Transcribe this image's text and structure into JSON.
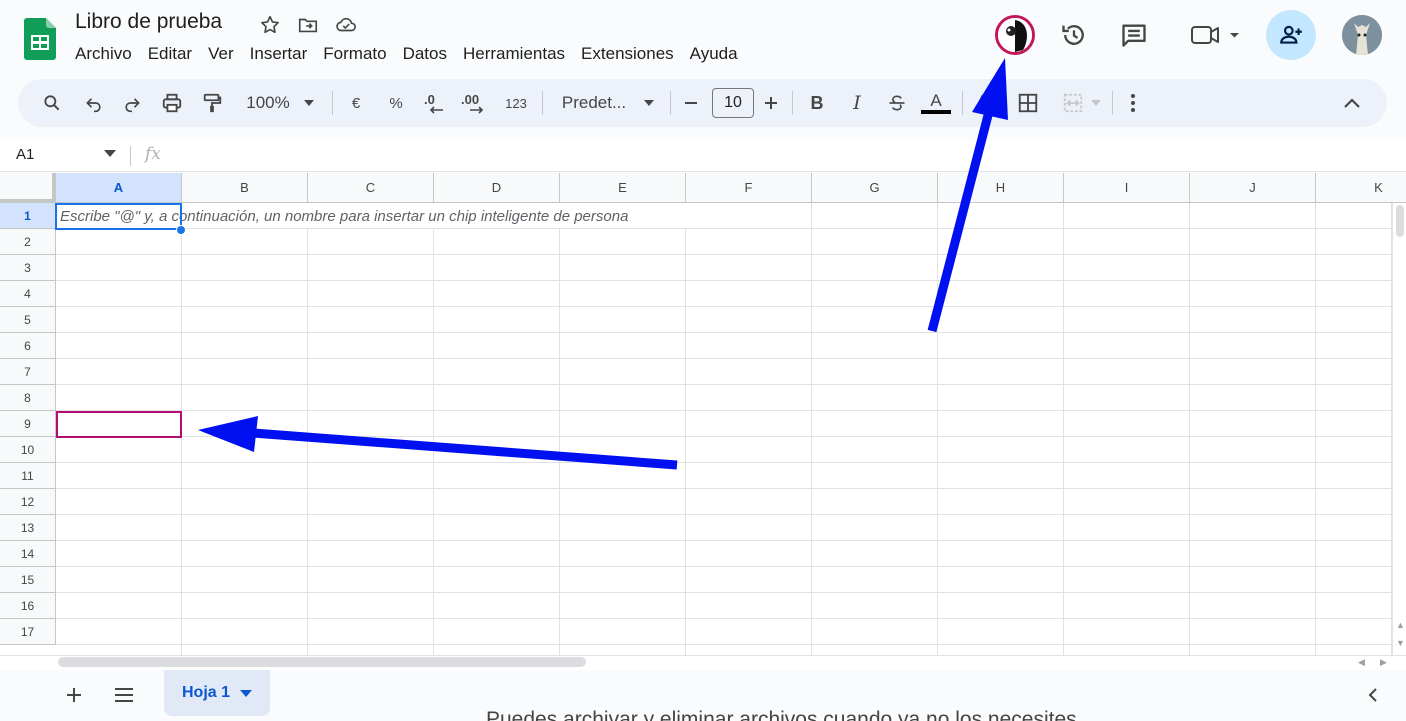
{
  "app": {
    "doc_title": "Libro de prueba",
    "brand_color": "#0f9d58",
    "accent_color": "#1a73e8",
    "collaborator_color": "#b10d75"
  },
  "title_icons": [
    "star-icon",
    "move-to-folder-icon",
    "cloud-saved-icon"
  ],
  "menu": [
    "Archivo",
    "Editar",
    "Ver",
    "Insertar",
    "Formato",
    "Datos",
    "Herramientas",
    "Extensiones",
    "Ayuda"
  ],
  "header_right": [
    "collaborator-avatar",
    "version-history-icon",
    "comments-icon",
    "meet-icon",
    "share-button",
    "user-avatar"
  ],
  "toolbar": {
    "zoom": "100%",
    "currency": "€",
    "percent": "%",
    "decrease_decimals": ".0",
    "increase_decimals": ".00",
    "number_format": "123",
    "font": "Predet...",
    "font_size": "10",
    "bold": "B",
    "italic": "I",
    "text_color": "A"
  },
  "formula_bar": {
    "cell_ref": "A1",
    "fx": "fx"
  },
  "columns": [
    "A",
    "B",
    "C",
    "D",
    "E",
    "F",
    "G",
    "H",
    "I",
    "J",
    "K"
  ],
  "rows": [
    "1",
    "2",
    "3",
    "4",
    "5",
    "6",
    "7",
    "8",
    "9",
    "10",
    "11",
    "12",
    "13",
    "14",
    "15",
    "16",
    "17"
  ],
  "cells": {
    "A1_hint": "Escribe \"@\" y, a continuación, un nombre para insertar un chip inteligente de persona"
  },
  "sheets": {
    "active": "Hoja 1"
  },
  "bottom_peek": "Puedes archivar y eliminar archivos cuando ya no los necesites."
}
